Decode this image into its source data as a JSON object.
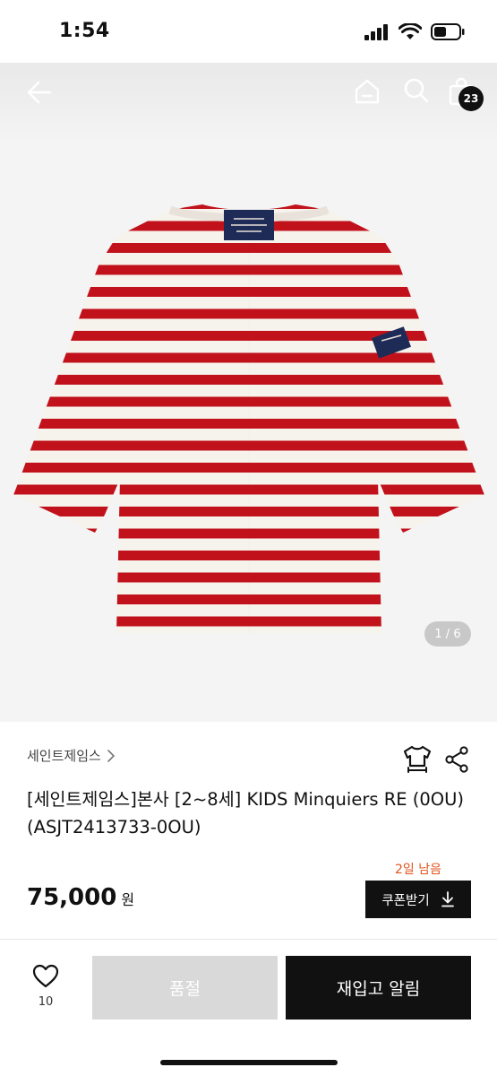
{
  "status_bar": {
    "time": "1:54"
  },
  "nav": {
    "cart_count": "23",
    "icons": [
      "back-arrow-icon",
      "home-icon",
      "search-icon",
      "shopping-bag-icon"
    ]
  },
  "gallery": {
    "counter": "1 / 6",
    "image_description_icon": "striped-shirt-image",
    "colors": {
      "stripe": "#c1121b",
      "base": "#f6f2ec",
      "background": "#f4f4f4"
    }
  },
  "product": {
    "brand": "세인트제임스",
    "title": "[세인트제임스]본사 [2~8세] KIDS Minquiers RE (0OU)(ASJT2413733-0OU)",
    "coupon_remaining": "2일 남음",
    "price": "75,000",
    "currency": "원",
    "coupon_button": "쿠폰받기"
  },
  "bottom_bar": {
    "like_count": "10",
    "soldout_label": "품절",
    "restock_label": "재입고 알림"
  },
  "theme": {
    "accent": "#111111",
    "coupon_text": "#e0541b",
    "disabled": "#d9d9d9"
  }
}
